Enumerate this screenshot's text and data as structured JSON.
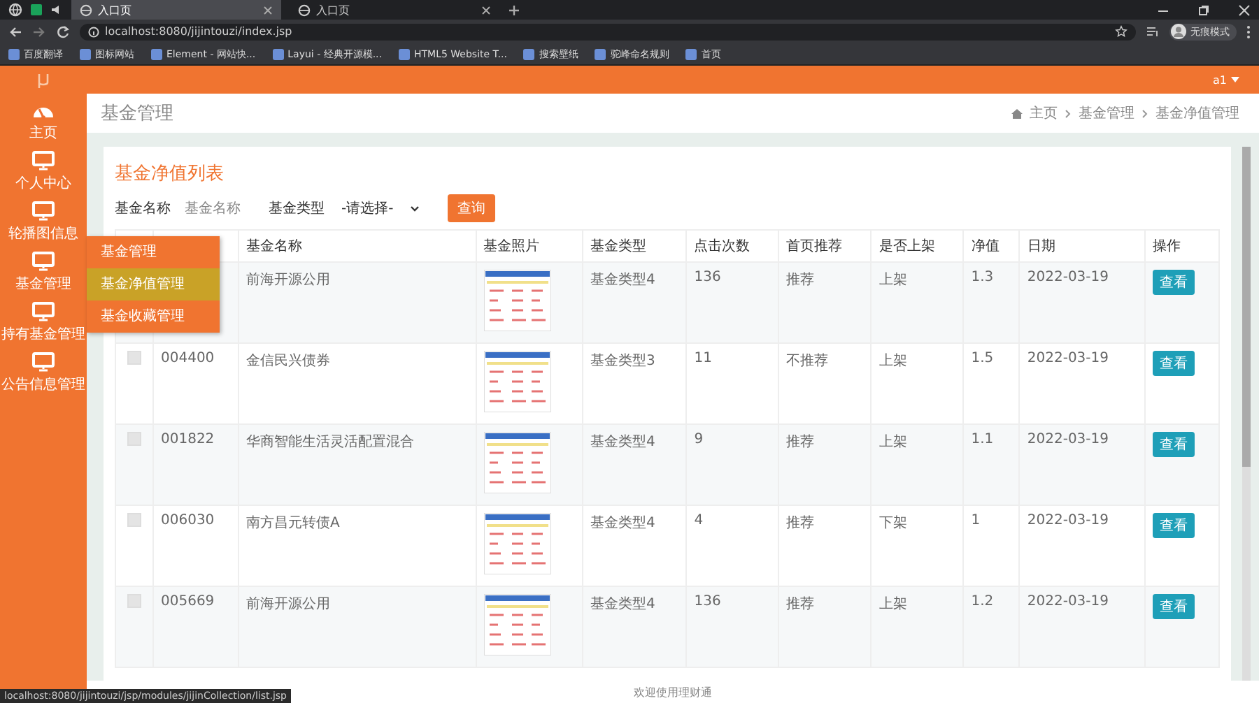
{
  "browser": {
    "tabs": [
      {
        "title": "入口页",
        "selected": true
      },
      {
        "title": "入口页",
        "selected": false
      }
    ],
    "address": "localhost:8080/jijintouzi/index.jsp",
    "profile": "无痕模式",
    "bookmarks": [
      "百度翻译",
      "图标网站",
      "Element - 网站快...",
      "Layui - 经典开源模...",
      "HTML5 Website T...",
      "搜索壁纸",
      "驼峰命名规则",
      "首页"
    ],
    "status_url": "localhost:8080/jijintouzi/jsp/modules/jijinCollection/list.jsp"
  },
  "header": {
    "user": "a1"
  },
  "sidebar": {
    "items": [
      {
        "label": "主页",
        "kind": "home"
      },
      {
        "label": "个人中心",
        "kind": "monitor"
      },
      {
        "label": "轮播图信息",
        "kind": "monitor"
      },
      {
        "label": "基金管理",
        "kind": "monitor"
      },
      {
        "label": "持有基金管理",
        "kind": "monitor"
      },
      {
        "label": "公告信息管理",
        "kind": "monitor"
      }
    ],
    "submenu": [
      {
        "label": "基金管理",
        "selected": false
      },
      {
        "label": "基金净值管理",
        "selected": true
      },
      {
        "label": "基金收藏管理",
        "selected": false
      }
    ]
  },
  "page": {
    "title": "基金管理",
    "breadcrumb": [
      "主页",
      "基金管理",
      "基金净值管理"
    ]
  },
  "card": {
    "title": "基金净值列表",
    "search": {
      "name_label": "基金名称",
      "name_placeholder": "基金名称",
      "type_label": "基金类型",
      "type_value": "-请选择-",
      "button": "查询"
    }
  },
  "table": {
    "columns": [
      "基金名称",
      "基金照片",
      "基金类型",
      "点击次数",
      "首页推荐",
      "是否上架",
      "净值",
      "日期",
      "操作"
    ],
    "rows": [
      {
        "name": "前海开源公用",
        "type": "基金类型4",
        "clicks": "136",
        "recommend": "推荐",
        "shelf": "上架",
        "nav": "1.3",
        "date": "2022-03-19",
        "action": "查看"
      },
      {
        "checked": false,
        "code": "004400",
        "name": "金信民兴债券",
        "type": "基金类型3",
        "clicks": "11",
        "recommend": "不推荐",
        "shelf": "上架",
        "nav": "1.5",
        "date": "2022-03-19",
        "action": "查看"
      },
      {
        "checked": false,
        "code": "001822",
        "name": "华商智能生活灵活配置混合",
        "type": "基金类型4",
        "clicks": "9",
        "recommend": "推荐",
        "shelf": "上架",
        "nav": "1.1",
        "date": "2022-03-19",
        "action": "查看"
      },
      {
        "checked": false,
        "code": "006030",
        "name": "南方昌元转债A",
        "type": "基金类型4",
        "clicks": "4",
        "recommend": "推荐",
        "shelf": "下架",
        "nav": "1",
        "date": "2022-03-19",
        "action": "查看"
      },
      {
        "checked": false,
        "code": "005669",
        "name": "前海开源公用",
        "type": "基金类型4",
        "clicks": "136",
        "recommend": "推荐",
        "shelf": "上架",
        "nav": "1.2",
        "date": "2022-03-19",
        "action": "查看"
      }
    ]
  },
  "footer": "欢迎使用理财通"
}
